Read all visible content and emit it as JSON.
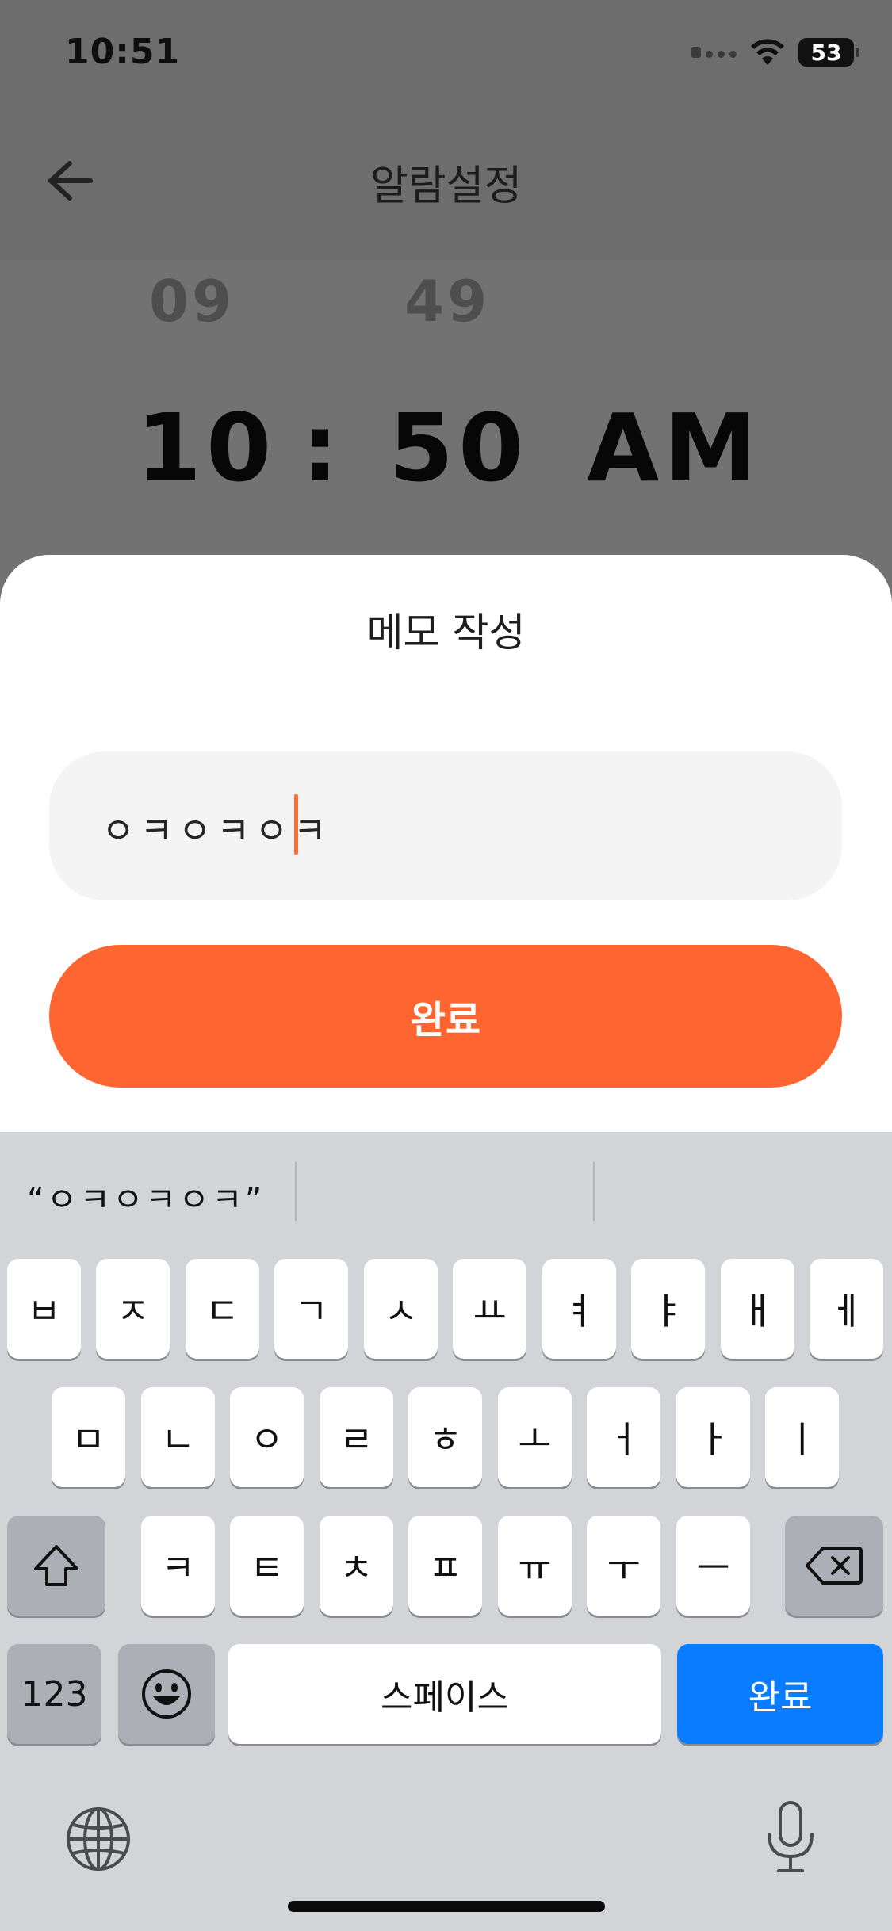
{
  "status_bar": {
    "time": "10:51",
    "battery": "53"
  },
  "header": {
    "title": "알람설정",
    "back_icon": "arrow-left-icon"
  },
  "time_picker": {
    "prev_hour": "09",
    "prev_minute": "49",
    "hour": "10",
    "separator": ":",
    "minute": "50",
    "period": "AM"
  },
  "memo_sheet": {
    "title": "메모 작성",
    "input_value": "ㅇㅋㅇㅋㅇㅋ",
    "done_label": "완료",
    "accent_color": "#ff6530"
  },
  "keyboard": {
    "suggestion": "“ㅇㅋㅇㅋㅇㅋ”",
    "row1": [
      "ㅂ",
      "ㅈ",
      "ㄷ",
      "ㄱ",
      "ㅅ",
      "ㅛ",
      "ㅕ",
      "ㅑ",
      "ㅐ",
      "ㅔ"
    ],
    "row2": [
      "ㅁ",
      "ㄴ",
      "ㅇ",
      "ㄹ",
      "ㅎ",
      "ㅗ",
      "ㅓ",
      "ㅏ",
      "ㅣ"
    ],
    "row3": [
      "ㅋ",
      "ㅌ",
      "ㅊ",
      "ㅍ",
      "ㅠ",
      "ㅜ",
      "ㅡ"
    ],
    "numbers_label": "123",
    "space_label": "스페이스",
    "return_label": "완료",
    "icons": {
      "shift": "shift-icon",
      "backspace": "backspace-icon",
      "emoji": "emoji-icon",
      "globe": "globe-icon",
      "mic": "microphone-icon"
    }
  }
}
